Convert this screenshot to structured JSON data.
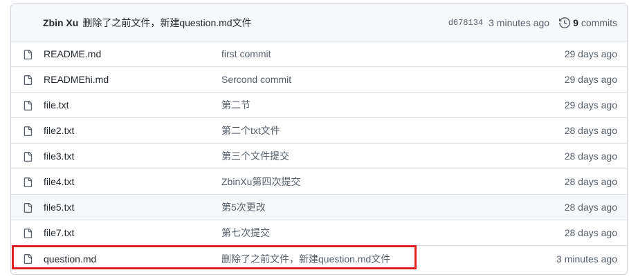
{
  "latest_commit": {
    "author": "Zbin Xu",
    "message": "删除了之前文件，新建question.md文件",
    "sha": "d678134",
    "age": "3 minutes ago",
    "commit_count": "9",
    "commits_label": "commits"
  },
  "files": [
    {
      "name": "README.md",
      "message": "first commit",
      "age": "29 days ago",
      "icon": "file-icon"
    },
    {
      "name": "READMEhi.md",
      "message": "Sercond commit",
      "age": "29 days ago",
      "icon": "file-icon"
    },
    {
      "name": "file.txt",
      "message": "第二节",
      "age": "29 days ago",
      "icon": "file-icon"
    },
    {
      "name": "file2.txt",
      "message": "第二个txt文件",
      "age": "28 days ago",
      "icon": "file-icon"
    },
    {
      "name": "file3.txt",
      "message": "第三个文件提交",
      "age": "28 days ago",
      "icon": "file-icon"
    },
    {
      "name": "file4.txt",
      "message": "ZbinXu第四次提交",
      "age": "28 days ago",
      "icon": "file-icon"
    },
    {
      "name": "file5.txt",
      "message": "第5次更改",
      "age": "28 days ago",
      "icon": "file-icon"
    },
    {
      "name": "file7.txt",
      "message": "第七次提交",
      "age": "28 days ago",
      "icon": "file-icon"
    },
    {
      "name": "question.md",
      "message": "删除了之前文件，新建question.md文件",
      "age": "3 minutes ago",
      "icon": "file-icon"
    }
  ],
  "colors": {
    "highlight_border": "#e02020",
    "border": "#d0d7de",
    "muted_text": "#57606a"
  }
}
